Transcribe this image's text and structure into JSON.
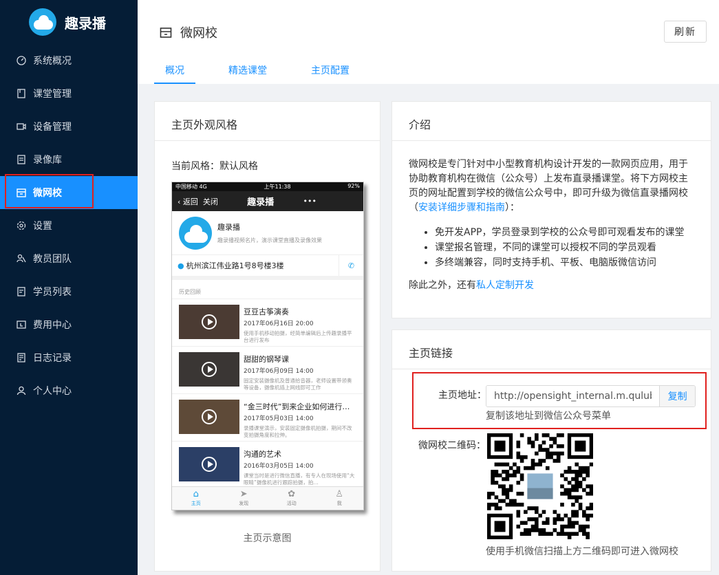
{
  "app": {
    "name": "趣录播"
  },
  "sidebar": {
    "items": [
      {
        "label": "系统概况",
        "icon": "dashboard-icon"
      },
      {
        "label": "课堂管理",
        "icon": "book-icon"
      },
      {
        "label": "设备管理",
        "icon": "camera-icon"
      },
      {
        "label": "录像库",
        "icon": "archive-icon"
      },
      {
        "label": "微网校",
        "icon": "store-icon",
        "active": true
      },
      {
        "label": "设置",
        "icon": "gear-icon"
      },
      {
        "label": "教员团队",
        "icon": "team-icon"
      },
      {
        "label": "学员列表",
        "icon": "list-icon"
      },
      {
        "label": "费用中心",
        "icon": "wallet-icon"
      },
      {
        "label": "日志记录",
        "icon": "log-icon"
      },
      {
        "label": "个人中心",
        "icon": "user-icon"
      }
    ]
  },
  "header": {
    "title": "微网校",
    "refresh_label": "刷新",
    "tabs": [
      {
        "label": "概况",
        "active": true
      },
      {
        "label": "精选课堂"
      },
      {
        "label": "主页配置"
      }
    ]
  },
  "style_card": {
    "title": "主页外观风格",
    "current_style": "当前风格：默认风格",
    "caption": "主页示意图",
    "phone": {
      "carrier": "中国移动 4G",
      "time": "上午11:38",
      "battery": "92%",
      "back": "返回",
      "close": "关闭",
      "title": "趣录播",
      "more": "•••",
      "profile_name": "趣录播",
      "profile_desc": "趣录播视频名片，演示课堂直播及录像效果",
      "address": "杭州滨江伟业路1号8号楼3楼",
      "history_label": "历史回顾",
      "videos": [
        {
          "title": "豆豆古筝演奏",
          "date": "2017年06月16日 20:00",
          "desc": "使用手机移动拍摄，经简单编辑后上传趣录播平台进行发布"
        },
        {
          "title": "甜甜的钢琴课",
          "date": "2017年06月09日 14:00",
          "desc": "固定安装摄像机及普通拾音器，老师设置带领奏等设备，摄像机插上网线即可工作"
        },
        {
          "title": "“金三时代”到来企业如何进行…",
          "date": "2017年05月03日 14:00",
          "desc": "录播课堂演示，安装固定摄像机拍摄，期间不改变拍摄角度和拉伸。"
        },
        {
          "title": "沟通的艺术",
          "date": "2016年03月05日 14:00",
          "desc": "课堂当时是进行微信直播，有专人在现场使用“大眼睛”摄像机进行跟踪拍摄，拍…"
        }
      ],
      "tabbar": [
        {
          "label": "主页",
          "icon": "home-icon"
        },
        {
          "label": "发现",
          "icon": "send-icon"
        },
        {
          "label": "活动",
          "icon": "paw-icon"
        },
        {
          "label": "我",
          "icon": "person-icon"
        }
      ]
    }
  },
  "intro_card": {
    "title": "介绍",
    "para_before": "微网校是专门针对中小型教育机构设计开发的一款网页应用，用于协助教育机构在微信（公众号）上发布直录播课堂。将下方网校主页的网址配置到学校的微信公众号中，即可升级为微信直录播网校（",
    "guide_link": "安装详细步骤和指南",
    "para_after": "）：",
    "bullets": [
      "免开发APP，学员登录到学校的公众号即可观看发布的课堂",
      "课堂报名管理，不同的课堂可以授权不同的学员观看",
      "多终端兼容，同时支持手机、平板、电脑版微信访问"
    ],
    "footer_prefix": "除此之外，还有",
    "footer_link": "私人定制开发"
  },
  "link_card": {
    "title": "主页链接",
    "url_label": "主页地址：",
    "url_value": "http://opensight_internal.m.qulubo",
    "copy_label": "复制",
    "url_hint": "复制该地址到微信公众号菜单",
    "qr_label": "微网校二维码：",
    "qr_hint": "使用手机微信扫描上方二维码即可进入微网校"
  },
  "colors": {
    "sidebar_bg": "#051d36",
    "accent": "#1890ff",
    "highlight": "#e0201e"
  }
}
